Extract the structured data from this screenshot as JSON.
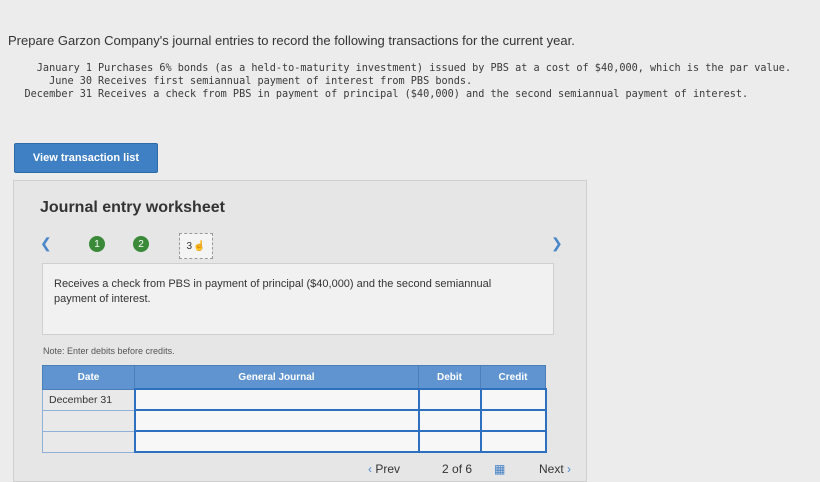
{
  "instructions": "Prepare Garzon Company's journal entries to record the following transactions for the current year.",
  "transactions": [
    {
      "date": "January 1",
      "desc": "Purchases 6% bonds (as a held-to-maturity investment) issued by PBS at a cost of $40,000, which is the par value."
    },
    {
      "date": "June 30",
      "desc": "Receives first semiannual payment of interest from PBS bonds."
    },
    {
      "date": "December 31",
      "desc": "Receives a check from PBS in payment of principal ($40,000) and the second semiannual payment of interest."
    }
  ],
  "view_button_label": "View transaction list",
  "worksheet": {
    "title": "Journal entry worksheet",
    "steps": [
      "1",
      "2",
      "3"
    ],
    "description": "Receives a check from PBS in payment of principal ($40,000) and the second semiannual payment of interest.",
    "note": "Note: Enter debits before credits.",
    "headers": {
      "date": "Date",
      "general_journal": "General Journal",
      "debit": "Debit",
      "credit": "Credit"
    },
    "rows": [
      {
        "date": "December 31",
        "account": "",
        "debit": "",
        "credit": ""
      },
      {
        "date": "",
        "account": "",
        "debit": "",
        "credit": ""
      },
      {
        "date": "",
        "account": "",
        "debit": "",
        "credit": ""
      }
    ]
  },
  "pagination": {
    "prev_label": "Prev",
    "current": "2",
    "of_label": "of",
    "total": "6",
    "next_label": "Next"
  },
  "colors": {
    "primary_blue": "#3f7fc4",
    "step_green": "#3a8a3a",
    "table_header": "#5f94d0"
  }
}
